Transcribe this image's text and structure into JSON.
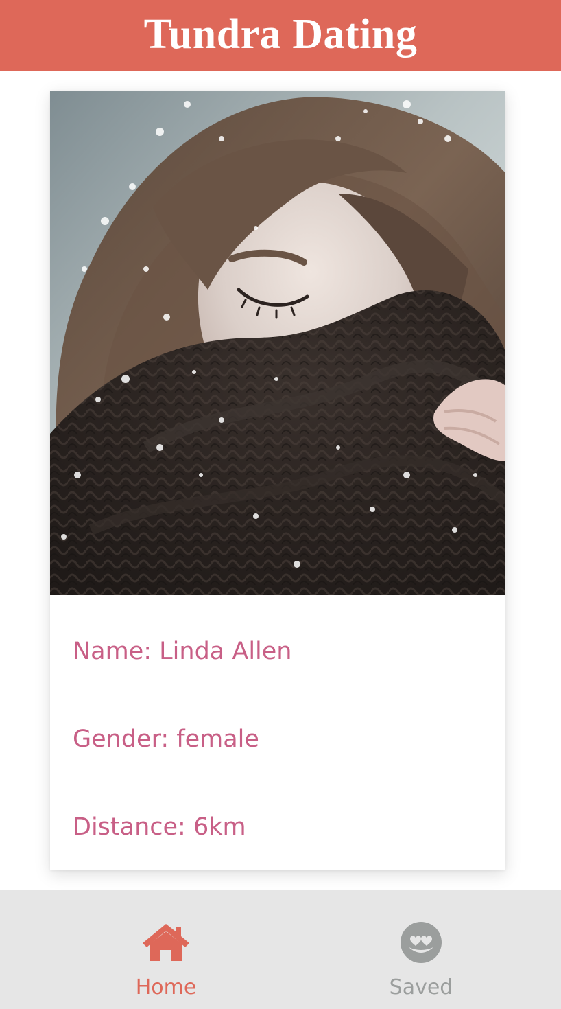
{
  "app": {
    "title": "Tundra Dating",
    "accent_color": "#de6859",
    "text_color": "#c85f86"
  },
  "profile": {
    "photo_icon": "profile-photo-woman-in-snow",
    "name_line": "Name: Linda Allen",
    "gender_line": "Gender: female",
    "distance_line": "Distance: 6km"
  },
  "nav": {
    "items": [
      {
        "label": "Home",
        "icon": "home-icon",
        "active": true,
        "color": "#de6859"
      },
      {
        "label": "Saved",
        "icon": "smile-heart-eyes-icon",
        "active": false,
        "color": "#9b9e9d"
      }
    ]
  }
}
